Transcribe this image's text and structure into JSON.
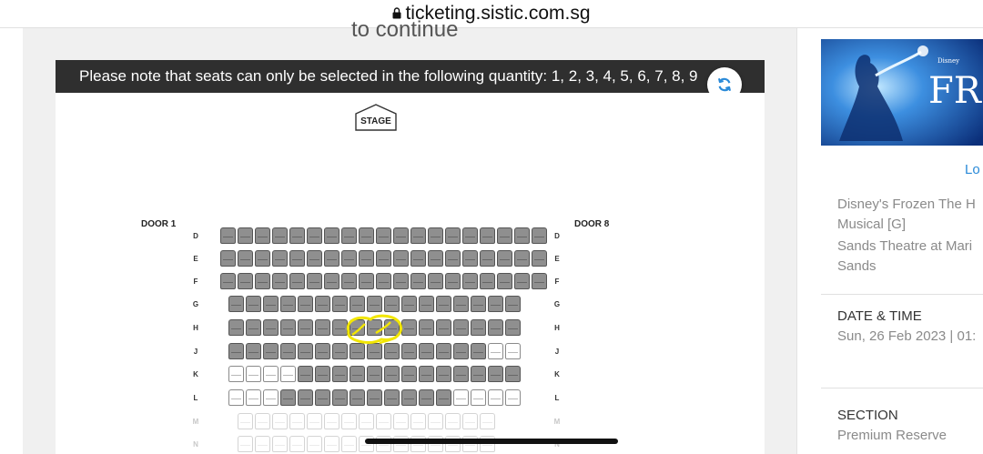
{
  "browser": {
    "url": "ticketing.sistic.com.sg"
  },
  "page": {
    "continue_text": "to continue",
    "notice": "Please note that seats can only be selected in the following quantity: 1, 2, 3, 4, 5, 6, 7, 8, 9"
  },
  "seatmap": {
    "stage_label": "STAGE",
    "door_left": "DOOR 1",
    "door_right": "DOOR 8",
    "rows": [
      {
        "label": "D",
        "light": false
      },
      {
        "label": "E",
        "light": false
      },
      {
        "label": "F",
        "light": false
      },
      {
        "label": "G",
        "light": false
      },
      {
        "label": "H",
        "light": false
      },
      {
        "label": "J",
        "light": false
      },
      {
        "label": "K",
        "light": false
      },
      {
        "label": "L",
        "light": false
      },
      {
        "label": "M",
        "light": true
      },
      {
        "label": "N",
        "light": true
      }
    ],
    "seat_rows": [
      "TTTTTTTTTTTTTTTTTTT",
      "TTTTTTTTTTTTTTTTTTT",
      "TTTTTTTTTTTTTTTTTTT",
      "TTTTTTTTTTTTTTTTT",
      "TTTTTTTTTTTTTTTTT",
      "TTTTTTTTTTTTTTTAA",
      "AAAATTTTTTTTTTTTT",
      "AAATTTTTTTTTTAAAA",
      "FFFFFFFFFFFFFFF",
      "FFFFFFFFFFFFFFF"
    ]
  },
  "sidebar": {
    "link_partial": "Lo",
    "event_title_line1": "Disney's Frozen The H",
    "event_title_line2": "Musical [G]",
    "venue_line1": "Sands Theatre at Mari",
    "venue_line2": "Sands",
    "date_heading": "DATE & TIME",
    "date_value": "Sun, 26 Feb 2023 | 01:",
    "section_heading": "SECTION",
    "section_value": "Premium Reserve",
    "poster_text": "FRO",
    "poster_brand": "Disney"
  },
  "colors": {
    "notice_bg": "#2f2f2f",
    "seat_taken": "#8f8f8f",
    "link": "#2a8ad8",
    "marker": "#f2e600"
  }
}
